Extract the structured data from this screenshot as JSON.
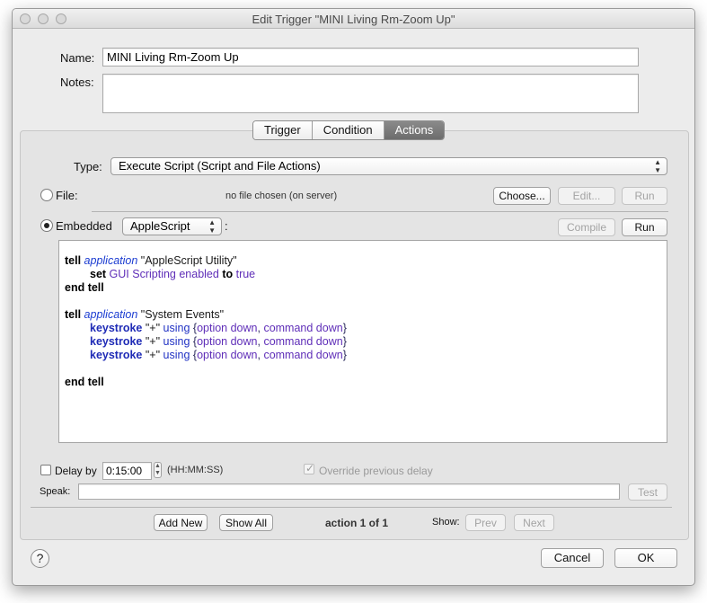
{
  "window": {
    "title": "Edit Trigger \"MINI Living Rm-Zoom Up\""
  },
  "form": {
    "name_label": "Name:",
    "name_value": "MINI Living Rm-Zoom Up",
    "notes_label": "Notes:",
    "notes_value": ""
  },
  "tabs": [
    {
      "label": "Trigger",
      "active": false
    },
    {
      "label": "Condition",
      "active": false
    },
    {
      "label": "Actions",
      "active": true
    }
  ],
  "actions": {
    "type_label": "Type:",
    "type_value": "Execute Script (Script and File Actions)",
    "file_label": "File:",
    "file_status": "no file chosen (on server)",
    "choose_button": "Choose...",
    "edit_button": "Edit...",
    "run_file_button": "Run",
    "embedded_label": "Embedded",
    "language_value": "AppleScript",
    "colon": ":",
    "compile_button": "Compile",
    "run_embedded_button": "Run",
    "script_lines": [
      [
        [
          "kw",
          "tell "
        ],
        [
          "it",
          "application"
        ],
        [
          "plain",
          " \"AppleScript Utility\""
        ]
      ],
      [
        [
          "ind",
          ""
        ],
        [
          "kw",
          "set "
        ],
        [
          "pu",
          "GUI Scripting enabled "
        ],
        [
          "kw",
          "to "
        ],
        [
          "pu",
          "true"
        ]
      ],
      [
        [
          "kw",
          "end tell"
        ]
      ],
      [
        [
          "plain",
          ""
        ]
      ],
      [
        [
          "kw",
          "tell "
        ],
        [
          "it",
          "application"
        ],
        [
          "plain",
          " \"System Events\""
        ]
      ],
      [
        [
          "ind",
          ""
        ],
        [
          "kwb",
          "keystroke "
        ],
        [
          "plain",
          "\"+\" "
        ],
        [
          "bl",
          "using "
        ],
        [
          "dark",
          "{"
        ],
        [
          "pu",
          "option down"
        ],
        [
          "dark",
          ", "
        ],
        [
          "pu",
          "command down"
        ],
        [
          "dark",
          "}"
        ]
      ],
      [
        [
          "ind",
          ""
        ],
        [
          "kwb",
          "keystroke "
        ],
        [
          "plain",
          "\"+\" "
        ],
        [
          "bl",
          "using "
        ],
        [
          "dark",
          "{"
        ],
        [
          "pu",
          "option down"
        ],
        [
          "dark",
          ", "
        ],
        [
          "pu",
          "command down"
        ],
        [
          "dark",
          "}"
        ]
      ],
      [
        [
          "ind",
          ""
        ],
        [
          "kwb",
          "keystroke "
        ],
        [
          "plain",
          "\"+\" "
        ],
        [
          "bl",
          "using "
        ],
        [
          "dark",
          "{"
        ],
        [
          "pu",
          "option down"
        ],
        [
          "dark",
          ", "
        ],
        [
          "pu",
          "command down"
        ],
        [
          "dark",
          "}"
        ]
      ],
      [
        [
          "plain",
          ""
        ]
      ],
      [
        [
          "kw",
          "end tell"
        ]
      ]
    ],
    "delay_label": "Delay by",
    "delay_value": "0:15:00",
    "delay_format": "(HH:MM:SS)",
    "override_label": "Override previous delay",
    "speak_label": "Speak:",
    "speak_value": "",
    "test_button": "Test",
    "add_new_button": "Add New",
    "show_all_button": "Show All",
    "action_counter": "action 1 of 1",
    "show_label": "Show:",
    "prev_button": "Prev",
    "next_button": "Next"
  },
  "footer": {
    "help_icon": "?",
    "cancel_button": "Cancel",
    "ok_button": "OK"
  },
  "icons": {
    "close": "window-close-icon",
    "minimize": "window-minimize-icon",
    "zoom": "window-zoom-icon",
    "popup_arrows": "up-down-arrows-icon",
    "help": "question-mark-icon",
    "check": "checkmark-icon"
  }
}
